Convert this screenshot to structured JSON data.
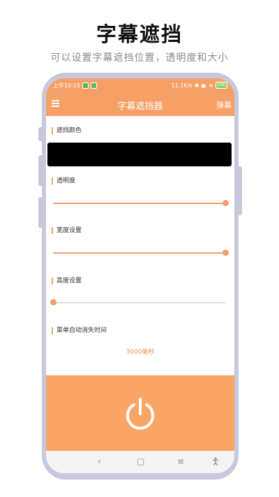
{
  "promo": {
    "title": "字幕遮挡",
    "subtitle": "可以设置字幕遮挡位置，透明度和大小"
  },
  "status_bar": {
    "time": "上午10:15",
    "network_speed": "11.1K/s",
    "battery": "100"
  },
  "app_bar": {
    "title": "字幕遮挡器",
    "menu_icon": "hamburger-menu-icon",
    "popup_label": "弹幕"
  },
  "settings": {
    "mask_color": {
      "label": "遮挡颜色",
      "color": "#000000"
    },
    "opacity": {
      "label": "透明度",
      "value_fraction": 1.0
    },
    "width": {
      "label": "宽度设置",
      "value_fraction": 1.0
    },
    "height": {
      "label": "高度设置",
      "value_fraction": 0.0
    },
    "auto_hide": {
      "label": "菜单自动消失时间",
      "value": "3000毫秒"
    }
  },
  "power": {
    "icon": "power-icon",
    "color": "#f9a566"
  },
  "nav_bar": {
    "back": "‹",
    "home": "▢",
    "menu": "≡",
    "accessibility": "accessibility-icon"
  },
  "colors": {
    "accent": "#f5a066",
    "frame": "#c7c8dc"
  }
}
